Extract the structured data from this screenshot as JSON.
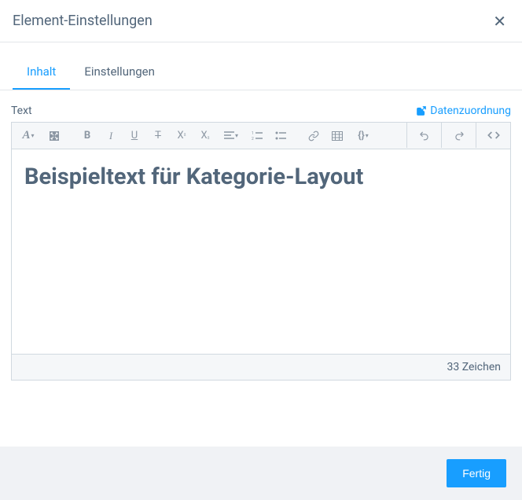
{
  "header": {
    "title": "Element-Einstellungen"
  },
  "tabs": {
    "content": "Inhalt",
    "settings": "Einstellungen"
  },
  "field": {
    "label": "Text",
    "dataMapping": "Datenzuordnung"
  },
  "editor": {
    "text": "Beispieltext für Kategorie-Layout",
    "charCount": "33 Zeichen"
  },
  "footer": {
    "done": "Fertig"
  }
}
